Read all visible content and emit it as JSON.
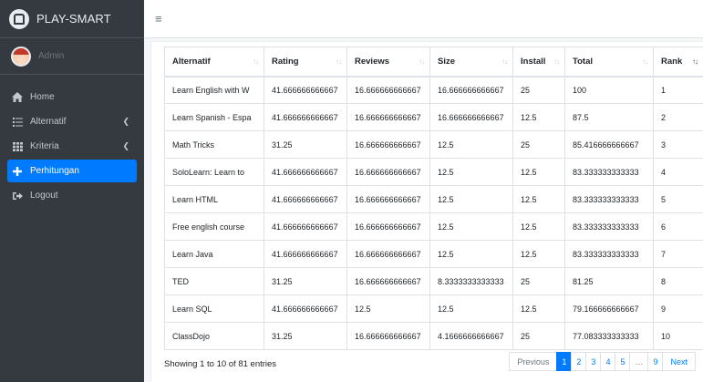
{
  "brand": {
    "name": "PLAY-SMART"
  },
  "user": {
    "name": "Admin"
  },
  "sidebar": {
    "items": [
      {
        "label": "Home",
        "icon": "home-icon"
      },
      {
        "label": "Alternatif",
        "icon": "list-icon"
      },
      {
        "label": "Kriteria",
        "icon": "table-icon"
      },
      {
        "label": "Perhitungan",
        "icon": "plus-icon"
      },
      {
        "label": "Logout",
        "icon": "sign-out-icon"
      }
    ],
    "active": "Perhitungan"
  },
  "table": {
    "columns": [
      "Alternatif",
      "Rating",
      "Reviews",
      "Size",
      "Install",
      "Total",
      "Rank"
    ],
    "rows": [
      [
        "Learn English with W",
        "41.666666666667",
        "16.666666666667",
        "16.666666666667",
        "25",
        "100",
        "1"
      ],
      [
        "Learn Spanish - Espa",
        "41.666666666667",
        "16.666666666667",
        "16.666666666667",
        "12.5",
        "87.5",
        "2"
      ],
      [
        "Math Tricks",
        "31.25",
        "16.666666666667",
        "12.5",
        "25",
        "85.416666666667",
        "3"
      ],
      [
        "SoloLearn: Learn to",
        "41.666666666667",
        "16.666666666667",
        "12.5",
        "12.5",
        "83.333333333333",
        "4"
      ],
      [
        "Learn HTML",
        "41.666666666667",
        "16.666666666667",
        "12.5",
        "12.5",
        "83.333333333333",
        "5"
      ],
      [
        "Free english course",
        "41.666666666667",
        "16.666666666667",
        "12.5",
        "12.5",
        "83.333333333333",
        "6"
      ],
      [
        "Learn Java",
        "41.666666666667",
        "16.666666666667",
        "12.5",
        "12.5",
        "83.333333333333",
        "7"
      ],
      [
        "TED",
        "31.25",
        "16.666666666667",
        "8.3333333333333",
        "25",
        "81.25",
        "8"
      ],
      [
        "Learn SQL",
        "41.666666666667",
        "12.5",
        "12.5",
        "12.5",
        "79.166666666667",
        "9"
      ],
      [
        "ClassDojo",
        "31.25",
        "16.666666666667",
        "4.1666666666667",
        "25",
        "77.083333333333",
        "10"
      ]
    ]
  },
  "info": "Showing 1 to 10 of 81 entries",
  "pagination": {
    "previous": "Previous",
    "pages": [
      "1",
      "2",
      "3",
      "4",
      "5",
      "…",
      "9"
    ],
    "next": "Next",
    "current": "1"
  },
  "colors": {
    "accent": "#007bff",
    "sidebar": "#343a40"
  }
}
